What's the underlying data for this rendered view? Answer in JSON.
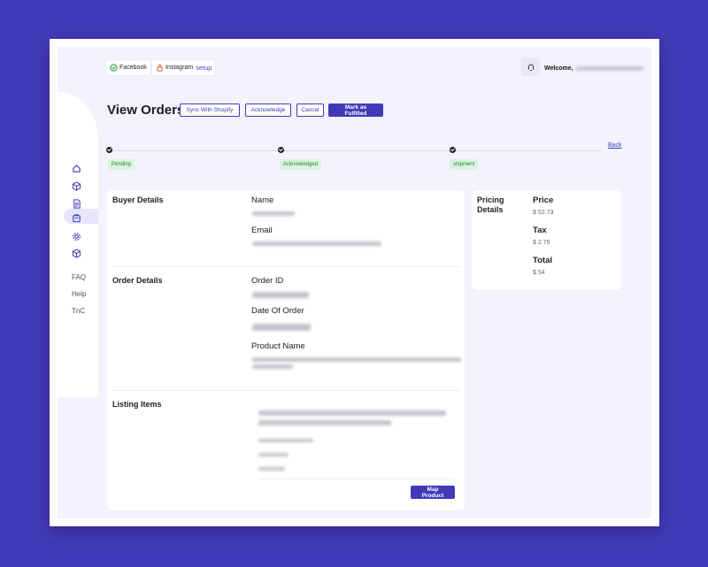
{
  "header": {
    "integrations": [
      {
        "name": "Facebook",
        "status": "connected"
      },
      {
        "name": "Instagram",
        "action": "setup"
      }
    ],
    "welcome": "Welcome,"
  },
  "sidebar": {
    "icons": [
      "home-icon",
      "box-icon",
      "document-icon",
      "orders-icon",
      "gear-icon",
      "cube-icon"
    ],
    "links": [
      "FAQ",
      "Help",
      "TnC"
    ]
  },
  "page": {
    "title": "View Orders",
    "actions": {
      "sync": "Sync With Shopify",
      "acknowledge": "Acknowledge",
      "cancel": "Cancel",
      "fulfill": "Mark as Fulfilled"
    },
    "back": "Back"
  },
  "progress": {
    "steps": [
      {
        "label": "Pending",
        "done": true
      },
      {
        "label": "Acknowledged",
        "done": true
      },
      {
        "label": "shipment",
        "done": true
      }
    ]
  },
  "buyer": {
    "section": "Buyer Details",
    "name_label": "Name",
    "email_label": "Email"
  },
  "order": {
    "section": "Order Details",
    "order_id_label": "Order ID",
    "date_label": "Date Of Order",
    "product_label": "Product Name"
  },
  "listing": {
    "section": "Listing Items",
    "map_button": "Map Product"
  },
  "pricing": {
    "section": "Pricing Details",
    "price_label": "Price",
    "price": "$ 52.73",
    "tax_label": "Tax",
    "tax": "$ 2.75",
    "total_label": "Total",
    "total": "$ 54"
  },
  "colors": {
    "accent": "#413ab8",
    "background": "#f3f2fd",
    "success_bg": "#d9f5dc",
    "success_text": "#2e7d3c"
  }
}
